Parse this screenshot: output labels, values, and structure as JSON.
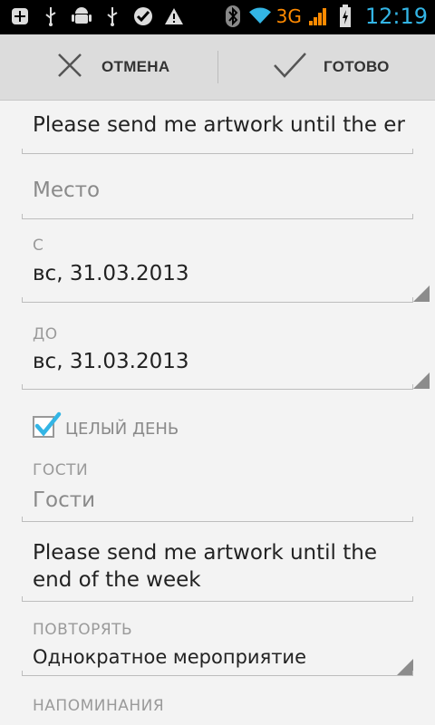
{
  "status_bar": {
    "left_icons": [
      "add-icon",
      "usb-icon",
      "android-icon",
      "usb-icon",
      "check-icon",
      "warning-icon"
    ],
    "right_icons": [
      "bluetooth-icon",
      "wifi-icon",
      "signal-icon",
      "battery-icon"
    ],
    "network": "3G",
    "time": "12:19",
    "colors": {
      "time": "#33b5e5",
      "network": "#ff8a00"
    }
  },
  "action_bar": {
    "cancel_label": "ОТМЕНА",
    "done_label": "ГОТОВО"
  },
  "form": {
    "title_value": "Please send me artwork until the er",
    "location_placeholder": "Место",
    "from_label": "С",
    "from_date": "вс, 31.03.2013",
    "to_label": "ДО",
    "to_date": "вс, 31.03.2013",
    "all_day_label": "ЦЕЛЫЙ ДЕНЬ",
    "all_day_checked": true,
    "guests_label": "ГОСТИ",
    "guests_placeholder": "Гости",
    "description_line1": "Please send me artwork until the",
    "description_line2": "end of the week",
    "repeat_label": "ПОВТОРЯТЬ",
    "repeat_value": "Однократное мероприятие",
    "reminders_label": "НАПОМИНАНИЯ"
  }
}
